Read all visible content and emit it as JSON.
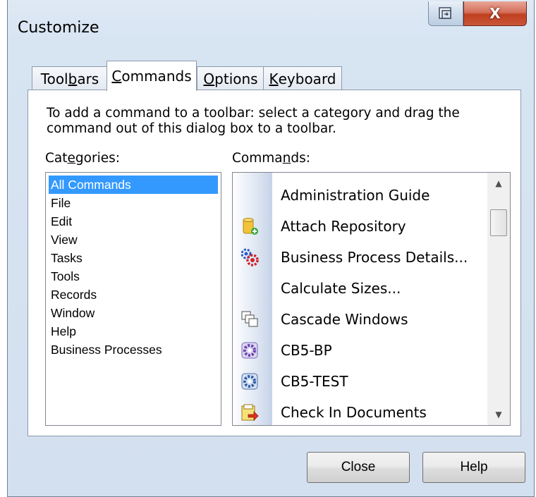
{
  "window": {
    "title": "Customize",
    "close_glyph": "X",
    "restore_icon": "restore-icon"
  },
  "tabs": [
    {
      "pre": "Tool",
      "u": "b",
      "post": "ars",
      "active": false
    },
    {
      "pre": "",
      "u": "C",
      "post": "ommands",
      "active": true
    },
    {
      "pre": "",
      "u": "O",
      "post": "ptions",
      "active": false
    },
    {
      "pre": "",
      "u": "K",
      "post": "eyboard",
      "active": false
    }
  ],
  "instructions": {
    "line1": "To add a command to a toolbar: select a category and drag the",
    "line2": "command out of this dialog box to a toolbar."
  },
  "categories_label": {
    "pre": "Cat",
    "u": "e",
    "post": "gories:"
  },
  "commands_label": {
    "pre": "Comma",
    "u": "n",
    "post": "ds:"
  },
  "categories": [
    {
      "label": "All Commands",
      "selected": true
    },
    {
      "label": "File",
      "selected": false
    },
    {
      "label": "Edit",
      "selected": false
    },
    {
      "label": "View",
      "selected": false
    },
    {
      "label": "Tasks",
      "selected": false
    },
    {
      "label": "Tools",
      "selected": false
    },
    {
      "label": "Records",
      "selected": false
    },
    {
      "label": "Window",
      "selected": false
    },
    {
      "label": "Help",
      "selected": false
    },
    {
      "label": "Business Processes",
      "selected": false
    }
  ],
  "commands": [
    {
      "label": "Administration Guide",
      "icon": ""
    },
    {
      "label": "Attach Repository",
      "icon": "database-add-icon"
    },
    {
      "label": "Business Process Details...",
      "icon": "gears-icon"
    },
    {
      "label": "Calculate Sizes...",
      "icon": ""
    },
    {
      "label": "Cascade Windows",
      "icon": "cascade-windows-icon"
    },
    {
      "label": "CB5-BP",
      "icon": "purple-gear-icon"
    },
    {
      "label": "CB5-TEST",
      "icon": "blue-gear-icon"
    },
    {
      "label": "Check In Documents",
      "icon": "check-in-icon"
    }
  ],
  "buttons": {
    "close": "Close",
    "help": "Help"
  },
  "colors": {
    "selection": "#3399ff",
    "close_button": "#c0401f"
  }
}
